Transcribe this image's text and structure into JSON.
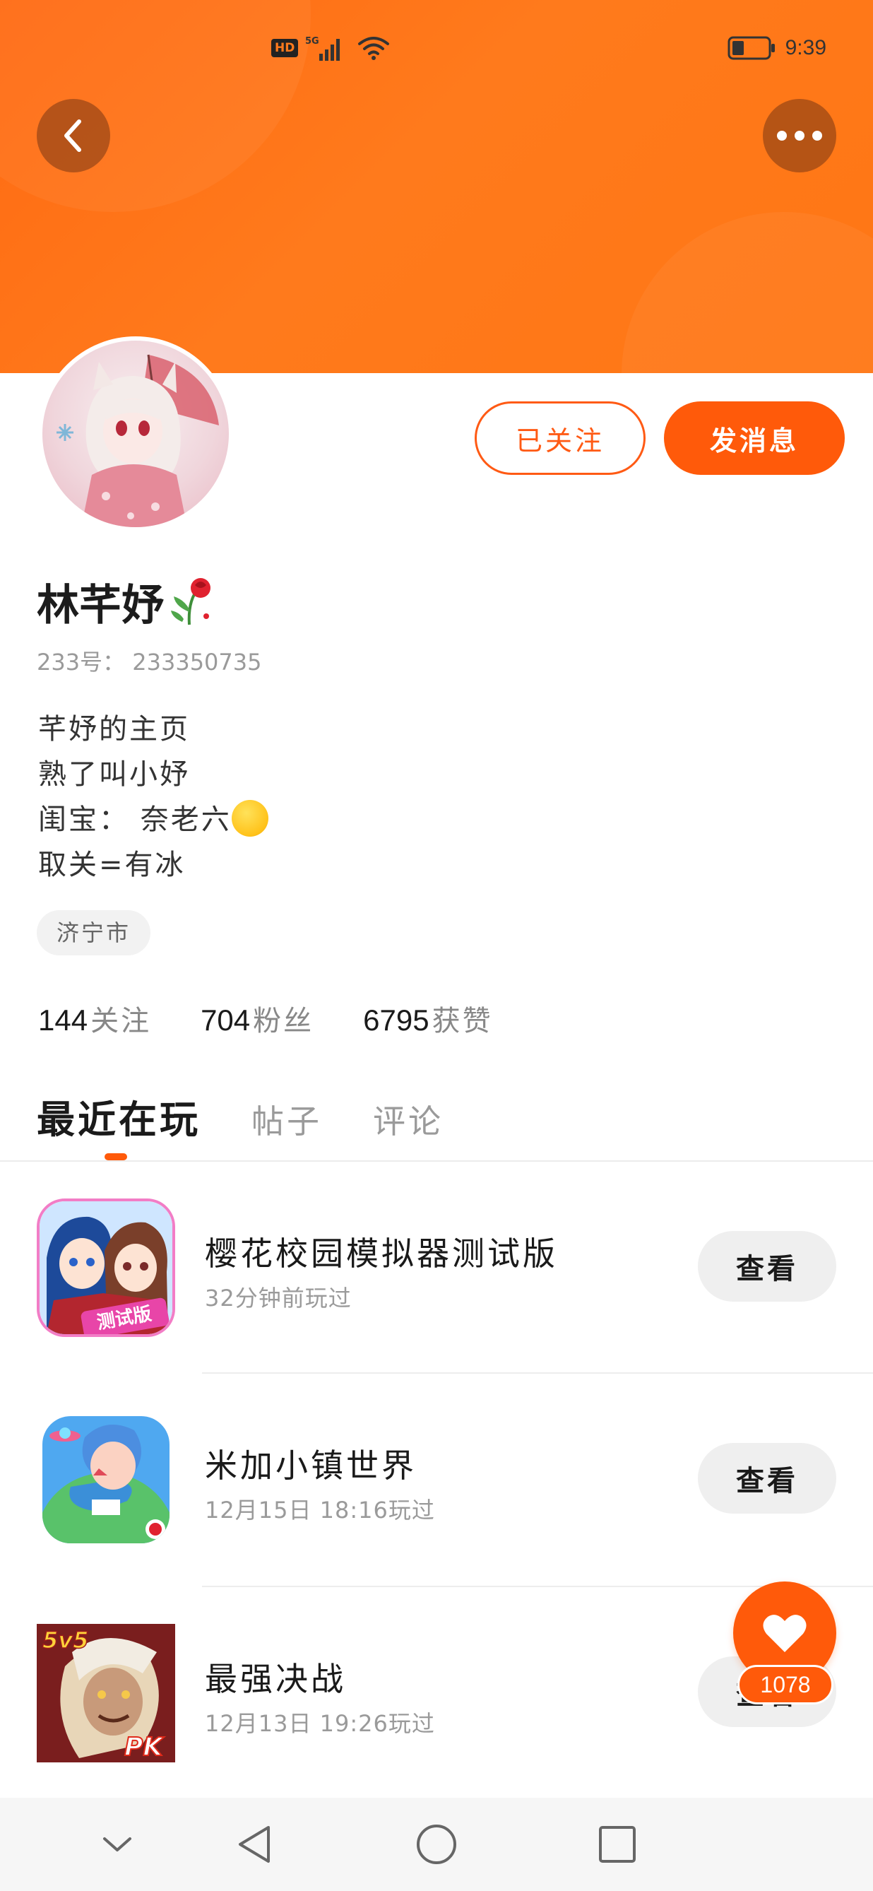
{
  "status_bar": {
    "hd": "HD",
    "network": "5G",
    "time": "9:39"
  },
  "profile": {
    "follow_status": "已关注",
    "message_button": "发消息",
    "name": "林芊妤",
    "id_text": "233号： 233350735",
    "bio": [
      "芊妤的主页",
      "熟了叫小妤",
      "闺宝： 奈老六",
      "取关=有冰"
    ],
    "location": "济宁市",
    "stats": {
      "following_count": "144",
      "following_label": "关注",
      "fans_count": "704",
      "fans_label": "粉丝",
      "likes_count": "6795",
      "likes_label": "获赞"
    }
  },
  "tabs": [
    {
      "label": "最近在玩",
      "active": true
    },
    {
      "label": "帖子",
      "active": false
    },
    {
      "label": "评论",
      "active": false
    }
  ],
  "games": [
    {
      "name": "樱花校园模拟器测试版",
      "time": "32分钟前玩过",
      "button": "查看",
      "icon": "sakura-school-icon",
      "badge": "测试版"
    },
    {
      "name": "米加小镇世界",
      "time": "12月15日  18:16玩过",
      "button": "查看",
      "icon": "miga-town-icon"
    },
    {
      "name": "最强决战",
      "time": "12月13日  19:26玩过",
      "button": "查看",
      "icon": "strongest-battle-icon",
      "badge_top": "5v5",
      "badge_bottom": "PK"
    }
  ],
  "like_fab": {
    "count": "1078",
    "icon": "heart-icon"
  },
  "colors": {
    "accent": "#ff5a0a",
    "banner": "#ff7a1c"
  }
}
